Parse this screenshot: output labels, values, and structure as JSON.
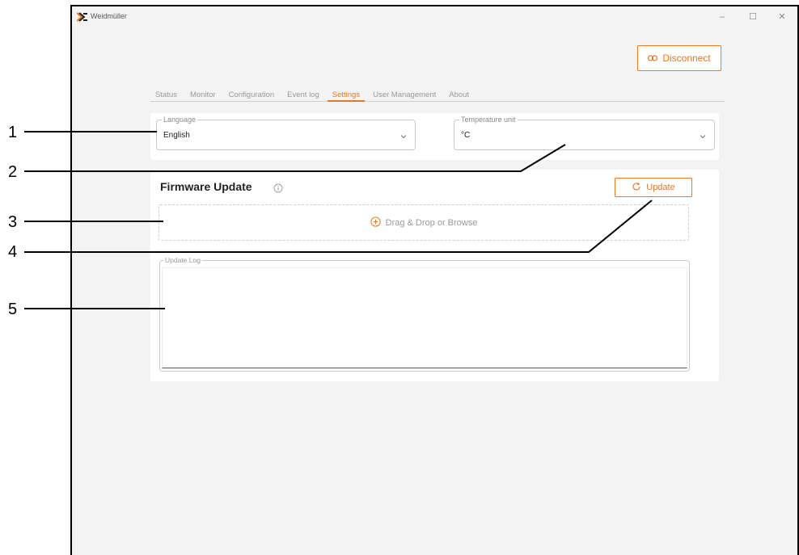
{
  "app": {
    "name": "Weidmüller"
  },
  "window_controls": {
    "minimize": "–",
    "maximize": "☐",
    "close": "✕"
  },
  "disconnect_label": "Disconnect",
  "tabs": [
    {
      "label": "Status"
    },
    {
      "label": "Monitor"
    },
    {
      "label": "Configuration"
    },
    {
      "label": "Event log"
    },
    {
      "label": "Settings",
      "active": true
    },
    {
      "label": "User Management"
    },
    {
      "label": "About"
    }
  ],
  "language": {
    "legend": "Language",
    "value": "English"
  },
  "temperature": {
    "legend": "Temperature unit",
    "value": "°C"
  },
  "firmware": {
    "title": "Firmware Update",
    "update_label": "Update",
    "dropzone_label": "Drag & Drop or Browse",
    "log_legend": "Update Log",
    "log_content": ""
  },
  "callouts": [
    "1",
    "2",
    "3",
    "4",
    "5"
  ],
  "icons": {
    "brand": "weidmuller-logo-icon",
    "disconnect": "link-broken-icon",
    "info": "info-circle-icon",
    "update": "refresh-icon",
    "dropzone": "plus-circle-icon",
    "dropdown": "chevron-down-icon"
  },
  "colors": {
    "accent": "#e87722",
    "background": "#f3f3f3",
    "card": "#ffffff"
  }
}
